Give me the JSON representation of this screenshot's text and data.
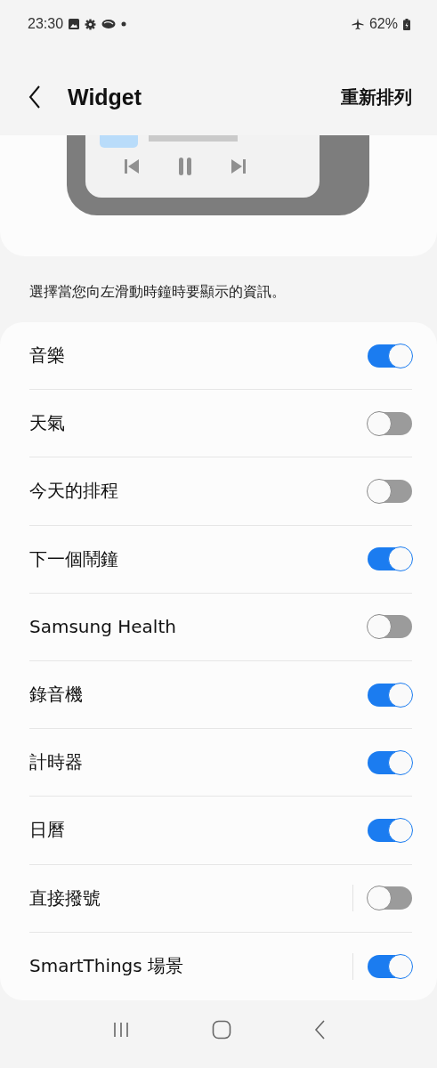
{
  "status_bar": {
    "time": "23:30",
    "battery": "62%"
  },
  "header": {
    "title": "Widget",
    "action": "重新排列"
  },
  "description": "選擇當您向左滑動時鐘時要顯示的資訊。",
  "items": [
    {
      "label": "音樂",
      "on": true,
      "kind": "plain"
    },
    {
      "label": "天氣",
      "on": false,
      "kind": "plain"
    },
    {
      "label": "今天的排程",
      "on": false,
      "kind": "plain"
    },
    {
      "label": "下一個鬧鐘",
      "on": true,
      "kind": "plain"
    },
    {
      "label": "Samsung Health",
      "on": false,
      "kind": "plain"
    },
    {
      "label": "錄音機",
      "on": true,
      "kind": "plain"
    },
    {
      "label": "計時器",
      "on": true,
      "kind": "plain"
    },
    {
      "label": "日曆",
      "on": true,
      "kind": "plain"
    },
    {
      "label": "直接撥號",
      "on": false,
      "kind": "divided"
    },
    {
      "label": "SmartThings 場景",
      "on": true,
      "kind": "divided"
    }
  ]
}
